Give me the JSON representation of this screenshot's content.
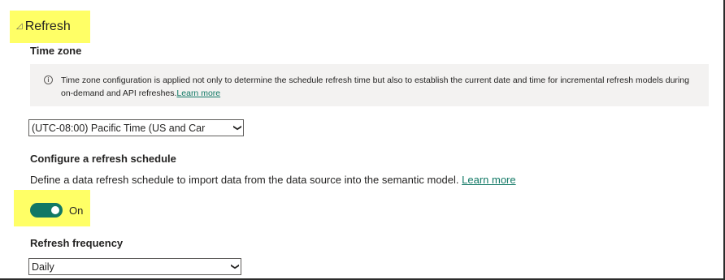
{
  "section": {
    "title": "Refresh",
    "collapse_icon": "triangle-expanded-icon"
  },
  "timezone": {
    "label": "Time zone",
    "info_icon": "info-icon",
    "info_text": "Time zone configuration is applied not only to determine the schedule refresh time but also to establish the current date and time for incremental refresh models during on-demand and API refreshes.",
    "info_link": "Learn more",
    "selected": "(UTC-08:00) Pacific Time (US and Car"
  },
  "schedule": {
    "label": "Configure a refresh schedule",
    "description": "Define a data refresh schedule to import data from the data source into the semantic model.",
    "link": "Learn more",
    "toggle_state": "On",
    "toggle_color": "#117865"
  },
  "frequency": {
    "label": "Refresh frequency",
    "selected": "Daily"
  },
  "colors": {
    "highlight": "#ffff66",
    "link": "#117865",
    "info_bg": "#f3f2f1"
  }
}
